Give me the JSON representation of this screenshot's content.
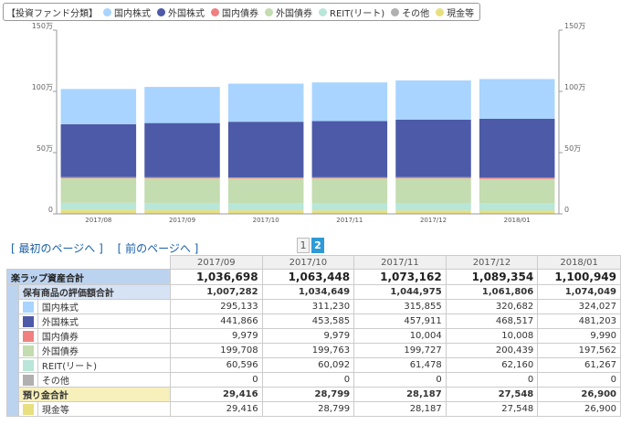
{
  "legend": {
    "title": "【投資ファンド分類】",
    "items": [
      {
        "label": "国内株式",
        "color": "#a8d4ff",
        "icon": "dot"
      },
      {
        "label": "外国株式",
        "color": "#4d5aa8",
        "icon": "dot"
      },
      {
        "label": "国内債券",
        "color": "#f08080",
        "icon": "dot"
      },
      {
        "label": "外国債券",
        "color": "#c3dcb0",
        "icon": "dot"
      },
      {
        "label": "REIT(リート)",
        "color": "#b8e6d8",
        "icon": "dot"
      },
      {
        "label": "その他",
        "color": "#b0b0b0",
        "icon": "dot"
      },
      {
        "label": "現金等",
        "color": "#e8df7e",
        "icon": "dot"
      }
    ]
  },
  "chart_data": {
    "type": "bar",
    "stacked": true,
    "categories": [
      "2017/08",
      "2017/09",
      "2017/10",
      "2017/11",
      "2017/12",
      "2018/01"
    ],
    "series": [
      {
        "name": "現金等",
        "color": "#e8df7e",
        "values": [
          31000,
          29416,
          28799,
          28187,
          27548,
          26900
        ]
      },
      {
        "name": "その他",
        "color": "#b0b0b0",
        "values": [
          0,
          0,
          0,
          0,
          0,
          0
        ]
      },
      {
        "name": "REIT(リート)",
        "color": "#b8e6d8",
        "values": [
          60000,
          60596,
          60092,
          61478,
          62160,
          61267
        ]
      },
      {
        "name": "外国債券",
        "color": "#c3dcb0",
        "values": [
          199500,
          199708,
          199763,
          199727,
          200439,
          197562
        ]
      },
      {
        "name": "国内債券",
        "color": "#f08080",
        "values": [
          9979,
          9979,
          9979,
          10004,
          10008,
          9990
        ]
      },
      {
        "name": "外国株式",
        "color": "#4d5aa8",
        "values": [
          432000,
          441866,
          453585,
          457911,
          468517,
          481203
        ]
      },
      {
        "name": "国内株式",
        "color": "#a8d4ff",
        "values": [
          287000,
          295133,
          311230,
          315855,
          320682,
          324027
        ]
      }
    ],
    "ylim": [
      0,
      1500000
    ],
    "yticks": [
      0,
      500000,
      1000000,
      1500000
    ],
    "yticklabels": [
      "0",
      "50万",
      "100万",
      "150万"
    ],
    "grid": false
  },
  "nav": {
    "first": "[ 最初のページへ ]",
    "prev": "[ 前のページへ ]"
  },
  "pager": {
    "pages": [
      "1",
      "2"
    ],
    "current": "2"
  },
  "table": {
    "months": [
      "2017/09",
      "2017/10",
      "2017/11",
      "2017/12",
      "2018/01"
    ],
    "total": {
      "label": "楽ラップ資産合計",
      "values": [
        "1,036,698",
        "1,063,448",
        "1,073,162",
        "1,089,354",
        "1,100,949"
      ]
    },
    "holdings": {
      "label": "保有商品の評価額合計",
      "values": [
        "1,007,282",
        "1,034,649",
        "1,044,975",
        "1,061,806",
        "1,074,049"
      ]
    },
    "rows": [
      {
        "label": "国内株式",
        "color": "#a8d4ff",
        "values": [
          "295,133",
          "311,230",
          "315,855",
          "320,682",
          "324,027"
        ]
      },
      {
        "label": "外国株式",
        "color": "#4d5aa8",
        "values": [
          "441,866",
          "453,585",
          "457,911",
          "468,517",
          "481,203"
        ]
      },
      {
        "label": "国内債券",
        "color": "#f08080",
        "values": [
          "9,979",
          "9,979",
          "10,004",
          "10,008",
          "9,990"
        ]
      },
      {
        "label": "外国債券",
        "color": "#c3dcb0",
        "values": [
          "199,708",
          "199,763",
          "199,727",
          "200,439",
          "197,562"
        ]
      },
      {
        "label": "REIT(リート)",
        "color": "#b8e6d8",
        "values": [
          "60,596",
          "60,092",
          "61,478",
          "62,160",
          "61,267"
        ]
      },
      {
        "label": "その他",
        "color": "#b0b0b0",
        "values": [
          "0",
          "0",
          "0",
          "0",
          "0"
        ]
      }
    ],
    "deposit": {
      "label": "預り金合計",
      "values": [
        "29,416",
        "28,799",
        "28,187",
        "27,548",
        "26,900"
      ]
    },
    "cash": {
      "label": "現金等",
      "color": "#e8df7e",
      "values": [
        "29,416",
        "28,799",
        "28,187",
        "27,548",
        "26,900"
      ]
    }
  }
}
